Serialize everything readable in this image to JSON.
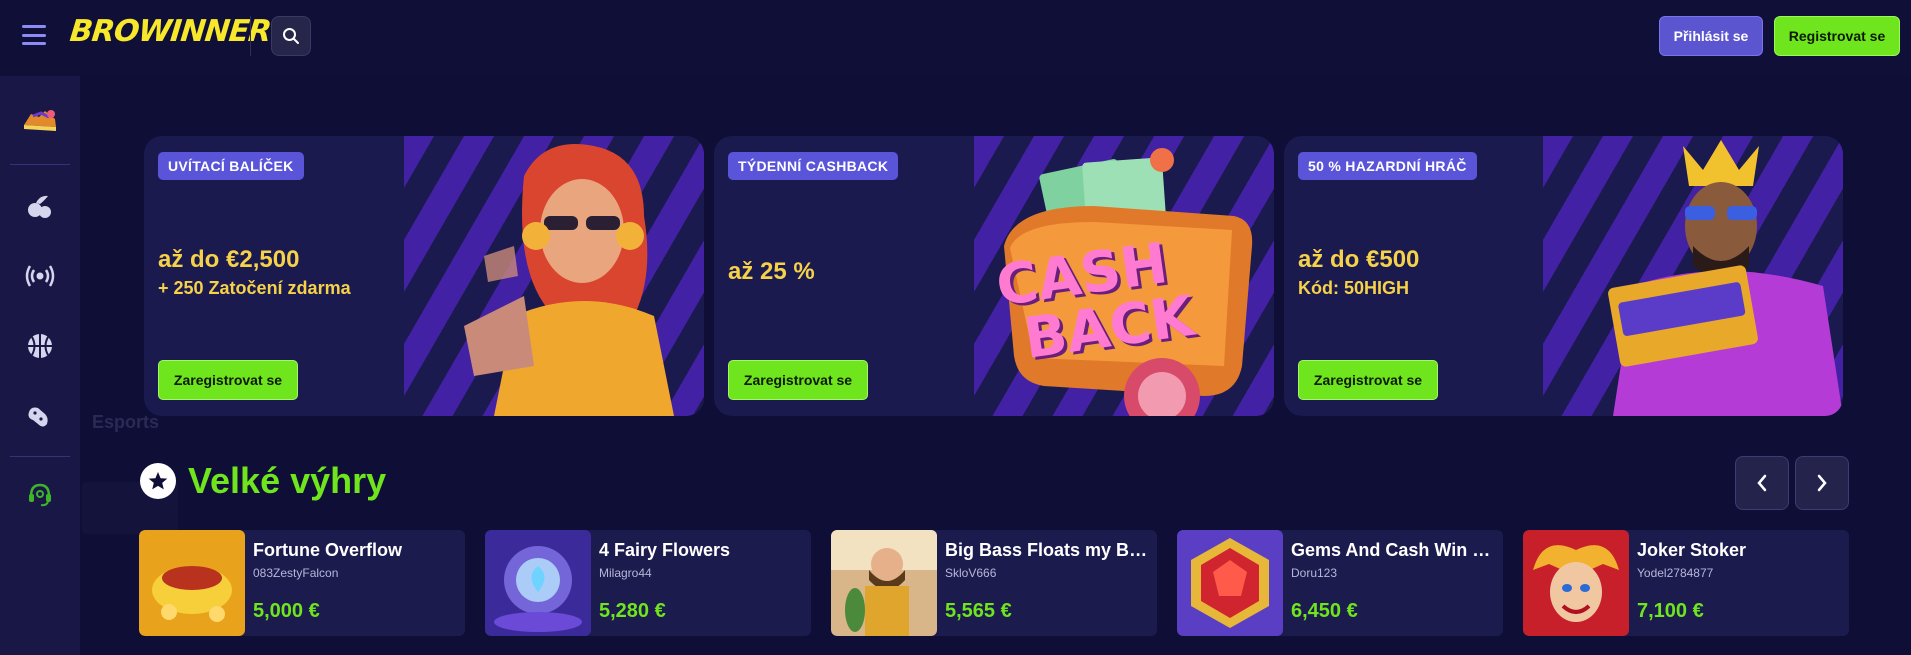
{
  "header": {
    "logo_text": "BROWINNER",
    "login_label": "Přihlásit se",
    "register_label": "Registrovat se"
  },
  "sidebar": {
    "items": [
      {
        "icon": "sneaker-icon"
      },
      {
        "icon": "fruits-icon"
      },
      {
        "icon": "live-broadcast-icon"
      },
      {
        "icon": "basketball-icon"
      },
      {
        "icon": "gamepad-icon"
      },
      {
        "icon": "headset-support-icon"
      }
    ],
    "ghost_label": "Esports"
  },
  "promos": [
    {
      "tag": "UVÍTACÍ BALÍČEK",
      "amount": "až do €2,500",
      "sub": "+ 250 Zatočení zdarma",
      "cta": "Zaregistrovat se"
    },
    {
      "tag": "TÝDENNÍ CASHBACK",
      "amount": "až 25 %",
      "sub": "",
      "cta": "Zaregistrovat se",
      "art_line1": "CASH",
      "art_line2": "BACK"
    },
    {
      "tag": "50 % HAZARDNÍ HRÁČ",
      "amount": "až do €500",
      "sub": "Kód: 50HIGH",
      "cta": "Zaregistrovat se"
    }
  ],
  "big_wins": {
    "title": "Velké výhry",
    "items": [
      {
        "game": "Fortune Overflow",
        "user": "083ZestyFalcon",
        "amount": "5,000 €"
      },
      {
        "game": "4 Fairy Flowers",
        "user": "Milagro44",
        "amount": "5,280 €"
      },
      {
        "game": "Big Bass Floats my Boat",
        "user": "SkloV666",
        "amount": "5,565 €"
      },
      {
        "game": "Gems And Cash Win Sp...",
        "user": "Doru123",
        "amount": "6,450 €"
      },
      {
        "game": "Joker Stoker",
        "user": "Yodel2784877",
        "amount": "7,100 €"
      }
    ]
  },
  "colors": {
    "background": "#0f0e36",
    "accent_green": "#6ee51c",
    "accent_purple": "#5c55d0",
    "promo_gold": "#f6d14a",
    "logo_yellow": "#f7e82b"
  }
}
